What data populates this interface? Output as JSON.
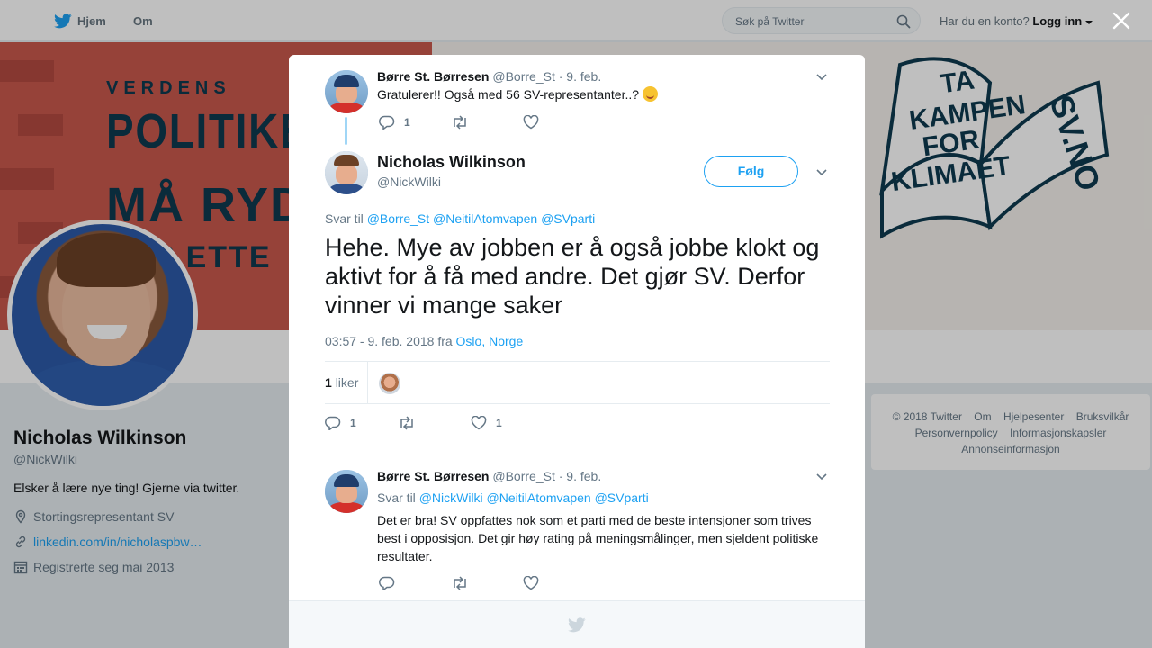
{
  "topbar": {
    "home_label": "Hjem",
    "about_label": "Om",
    "search_placeholder": "Søk på Twitter",
    "account_prompt": "Har du en konto?",
    "login_label": "Logg inn"
  },
  "banner": {
    "left_line1": "VERDENS",
    "left_line2": "POLITIKERR",
    "left_line3": "MÅ RYDDI",
    "left_line4": "OPP ETTE",
    "right_line1": "TA",
    "right_line2": "KAMPEN",
    "right_line3": "FOR",
    "right_line4": "KLIMAET",
    "right_line5": "SV.NO"
  },
  "profile": {
    "name": "Nicholas Wilkinson",
    "handle": "@NickWilki",
    "bio": "Elsker å lære nye ting! Gjerne via twitter.",
    "location": "Stortingsrepresentant SV",
    "website": "linkedin.com/in/nicholaspbw…",
    "joined": "Registrerte seg mai 2013"
  },
  "footer": {
    "copyright": "© 2018 Twitter",
    "about": "Om",
    "help": "Hjelpesenter",
    "terms": "Bruksvilkår",
    "privacy": "Personvernpolicy",
    "cookies": "Informasjonskapsler",
    "ads": "Annonseinformasjon"
  },
  "parent_tweet": {
    "name": "Børre St. Børresen",
    "handle": "@Borre_St",
    "date": "· 9. feb.",
    "text": "Gratulerer!! Også med 56 SV-representanter..?",
    "reply_count": "1"
  },
  "main_tweet": {
    "name": "Nicholas Wilkinson",
    "handle": "@NickWilki",
    "follow_label": "Følg",
    "reply_prefix": "Svar til",
    "reply_mentions": "@Borre_St @NeitilAtomvapen @SVparti",
    "text": "Hehe. Mye av jobben er å også jobbe klokt og aktivt for å få med andre. Det gjør SV. Derfor vinner vi mange saker",
    "timestamp": "03:57 - 9. feb. 2018 fra",
    "location": "Oslo, Norge",
    "likes_count": "1",
    "likes_label": "liker",
    "reply_count": "1",
    "like_count": "1"
  },
  "reply_tweet": {
    "name": "Børre St. Børresen",
    "handle": "@Borre_St",
    "date": "· 9. feb.",
    "reply_prefix": "Svar til",
    "reply_mentions": "@NickWilki @NeitilAtomvapen @SVparti",
    "text": "Det er bra! SV oppfattes nok som et parti med de beste intensjoner som trives best i opposisjon. Det gir høy rating på meningsmålinger, men sjeldent politiske resultater."
  },
  "colors": {
    "accent": "#1da1f2",
    "text_primary": "#14171a",
    "text_secondary": "#657786",
    "border": "#e6ecf0"
  }
}
